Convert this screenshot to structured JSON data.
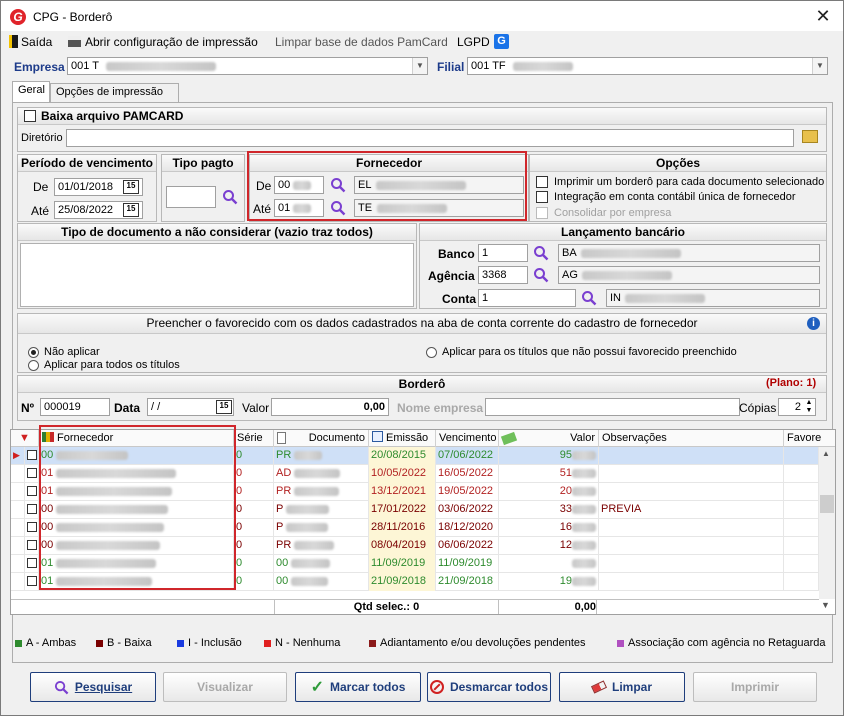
{
  "window": {
    "title": "CPG - Borderô",
    "close": "✕"
  },
  "menu": {
    "exit": "Saída",
    "print_config": "Abrir configuração de impressão",
    "clear_db": "Limpar base de dados PamCard",
    "lgpd": "LGPD"
  },
  "empresa": {
    "label": "Empresa",
    "value": "001 T"
  },
  "filial": {
    "label": "Filial",
    "value": "001 TF"
  },
  "tabs": [
    {
      "label": "Geral"
    },
    {
      "label": "Opções de impressão"
    }
  ],
  "pamcard": {
    "label": "Baixa arquivo PAMCARD",
    "dir_label": "Diretório"
  },
  "periodo": {
    "title": "Período de vencimento",
    "de_label": "De",
    "de_value": "01/01/2018",
    "ate_label": "Até",
    "ate_value": "25/08/2022"
  },
  "tipo_pagto": {
    "title": "Tipo pagto"
  },
  "fornecedor": {
    "title": "Fornecedor",
    "de_label": "De",
    "de_code": "00",
    "de_name": "EL",
    "ate_label": "Até",
    "ate_code": "01",
    "ate_name": "TE"
  },
  "opcoes": {
    "title": "Opções",
    "opt1": "Imprimir um borderô para cada documento selecionado",
    "opt2": "Integração em conta contábil única de fornecedor",
    "opt3": "Consolidar por empresa"
  },
  "tipo_doc": {
    "title": "Tipo de documento a não considerar (vazio traz todos)"
  },
  "lancamento": {
    "title": "Lançamento bancário",
    "banco_label": "Banco",
    "banco_code": "1",
    "banco_name": "BA",
    "agencia_label": "Agência",
    "agencia_code": "3368",
    "agencia_name": "AG",
    "conta_label": "Conta",
    "conta_code": "1",
    "conta_name": "IN"
  },
  "favorecido": {
    "title": "Preencher o favorecido com os dados cadastrados na aba de conta corrente do cadastro de fornecedor",
    "opt_nao": "Não aplicar",
    "opt_todos": "Aplicar para todos os títulos",
    "opt_sem": "Aplicar para os títulos que não possui favorecido preenchido"
  },
  "bordero": {
    "title": "Borderô",
    "plano": "(Plano: 1)",
    "n_label": "Nº",
    "n_value": "000019",
    "data_label": "Data",
    "data_value": " / /",
    "valor_label": "Valor",
    "valor_value": "0,00",
    "empresa_label": "Nome empresa",
    "copias_label": "Cópias",
    "copias_value": "2"
  },
  "grid": {
    "headers": [
      "Fornecedor",
      "Série",
      "Documento",
      "Emissão",
      "Vencimento",
      "Valor",
      "Observações",
      "Favore"
    ],
    "rows": [
      {
        "forn": "00",
        "serie": "0",
        "doc": "PR",
        "emissao": "20/08/2015",
        "venc": "07/06/2022",
        "valor": "95",
        "obs": "",
        "color": "#2e8b2e",
        "selected": true
      },
      {
        "forn": "01",
        "serie": "0",
        "doc": "AD",
        "emissao": "10/05/2022",
        "venc": "16/05/2022",
        "valor": "51",
        "obs": "",
        "color": "#b22222",
        "selected": false
      },
      {
        "forn": "01",
        "serie": "0",
        "doc": "PR",
        "emissao": "13/12/2021",
        "venc": "19/05/2022",
        "valor": "20",
        "obs": "",
        "color": "#b22222",
        "selected": false
      },
      {
        "forn": "00",
        "serie": "0",
        "doc": "P",
        "emissao": "17/01/2022",
        "venc": "03/06/2022",
        "valor": "33",
        "obs": "PREVIA",
        "color": "#7a0000",
        "selected": false
      },
      {
        "forn": "00",
        "serie": "0",
        "doc": "P",
        "emissao": "28/11/2016",
        "venc": "18/12/2020",
        "valor": "16",
        "obs": "",
        "color": "#7a0000",
        "selected": false
      },
      {
        "forn": "00",
        "serie": "0",
        "doc": "PR",
        "emissao": "08/04/2019",
        "venc": "06/06/2022",
        "valor": "12",
        "obs": "",
        "color": "#7a0000",
        "selected": false
      },
      {
        "forn": "01",
        "serie": "0",
        "doc": "00",
        "emissao": "11/09/2019",
        "venc": "11/09/2019",
        "valor": "",
        "obs": "",
        "color": "#2e8b2e",
        "selected": false
      },
      {
        "forn": "01",
        "serie": "0",
        "doc": "00",
        "emissao": "21/09/2018",
        "venc": "21/09/2018",
        "valor": "19",
        "obs": "",
        "color": "#2e8b2e",
        "selected": false
      }
    ],
    "qtd_label": "Qtd selec.: 0",
    "total": "0,00"
  },
  "legend": [
    {
      "label": "A - Ambas",
      "color": "#2e8b2e"
    },
    {
      "label": "B - Baixa",
      "color": "#7a0000"
    },
    {
      "label": "I - Inclusão",
      "color": "#1a3be0"
    },
    {
      "label": "N - Nenhuma",
      "color": "#e02020"
    },
    {
      "label": "Adiantamento e/ou devoluções pendentes",
      "color": "#8b1a1a"
    },
    {
      "label": "Associação com agência no Retaguarda",
      "color": "#b050c0"
    }
  ],
  "buttons": {
    "pesquisar": "Pesquisar",
    "visualizar": "Visualizar",
    "marcar": "Marcar todos",
    "desmarcar": "Desmarcar todos",
    "limpar": "Limpar",
    "imprimir": "Imprimir"
  }
}
